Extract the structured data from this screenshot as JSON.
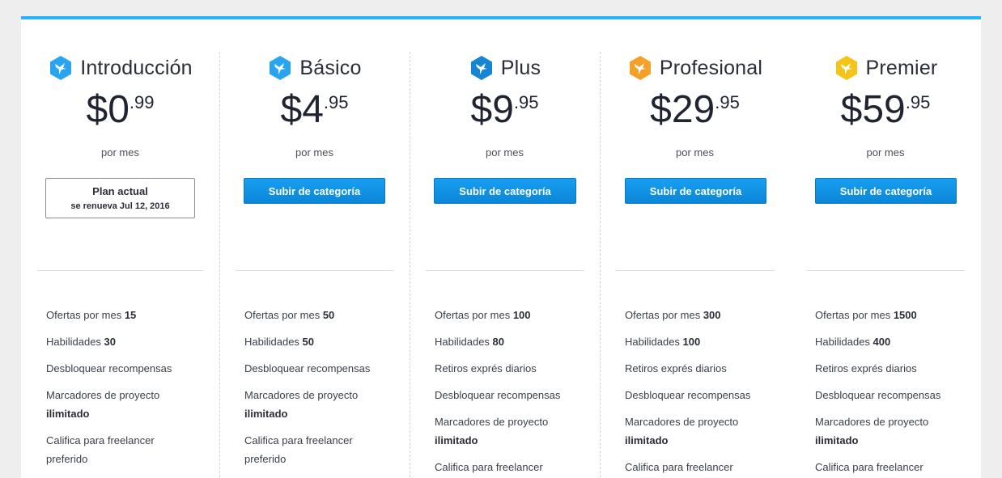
{
  "colors": {
    "accent_bar": "#29b2fe",
    "button_blue": "#0b86d8",
    "icon_blue": "#29a5ef",
    "icon_blue_dark": "#1585d4",
    "icon_orange": "#f5a02a",
    "icon_yellow": "#f6c419"
  },
  "plans": [
    {
      "name": "Introducción",
      "icon": "hummingbird-icon",
      "price_main": "$0",
      "price_cents": ".99",
      "period": "por mes",
      "current_label": "Plan actual",
      "renews": "se renueva Jul 12, 2016",
      "features": [
        {
          "text": "Ofertas por mes ",
          "bold": "15"
        },
        {
          "text": "Habilidades ",
          "bold": "30"
        },
        {
          "text": "Desbloquear recompensas",
          "bold": ""
        },
        {
          "text": "Marcadores de proyecto ",
          "bold": "ilimitado"
        },
        {
          "text": "Califica para freelancer preferido",
          "bold": ""
        }
      ]
    },
    {
      "name": "Básico",
      "icon": "hummingbird-icon",
      "price_main": "$4",
      "price_cents": ".95",
      "period": "por mes",
      "button": "Subir de categoría",
      "features": [
        {
          "text": "Ofertas por mes ",
          "bold": "50"
        },
        {
          "text": "Habilidades ",
          "bold": "50"
        },
        {
          "text": "Desbloquear recompensas",
          "bold": ""
        },
        {
          "text": "Marcadores de proyecto ",
          "bold": "ilimitado"
        },
        {
          "text": "Califica para freelancer preferido",
          "bold": ""
        }
      ]
    },
    {
      "name": "Plus",
      "icon": "hummingbird-icon",
      "price_main": "$9",
      "price_cents": ".95",
      "period": "por mes",
      "button": "Subir de categoría",
      "features": [
        {
          "text": "Ofertas por mes ",
          "bold": "100"
        },
        {
          "text": "Habilidades ",
          "bold": "80"
        },
        {
          "text": "Retiros exprés diarios",
          "bold": ""
        },
        {
          "text": "Desbloquear recompensas",
          "bold": ""
        },
        {
          "text": "Marcadores de proyecto ",
          "bold": "ilimitado"
        },
        {
          "text": "Califica para freelancer",
          "bold": ""
        }
      ]
    },
    {
      "name": "Profesional",
      "icon": "hummingbird-icon",
      "price_main": "$29",
      "price_cents": ".95",
      "period": "por mes",
      "button": "Subir de categoría",
      "features": [
        {
          "text": "Ofertas por mes ",
          "bold": "300"
        },
        {
          "text": "Habilidades ",
          "bold": "100"
        },
        {
          "text": "Retiros exprés diarios",
          "bold": ""
        },
        {
          "text": "Desbloquear recompensas",
          "bold": ""
        },
        {
          "text": "Marcadores de proyecto ",
          "bold": "ilimitado"
        },
        {
          "text": "Califica para freelancer",
          "bold": ""
        }
      ]
    },
    {
      "name": "Premier",
      "icon": "hummingbird-icon",
      "price_main": "$59",
      "price_cents": ".95",
      "period": "por mes",
      "button": "Subir de categoría",
      "features": [
        {
          "text": "Ofertas por mes ",
          "bold": "1500"
        },
        {
          "text": "Habilidades ",
          "bold": "400"
        },
        {
          "text": "Retiros exprés diarios",
          "bold": ""
        },
        {
          "text": "Desbloquear recompensas",
          "bold": ""
        },
        {
          "text": "Marcadores de proyecto ",
          "bold": "ilimitado"
        },
        {
          "text": "Califica para freelancer",
          "bold": ""
        }
      ]
    }
  ]
}
